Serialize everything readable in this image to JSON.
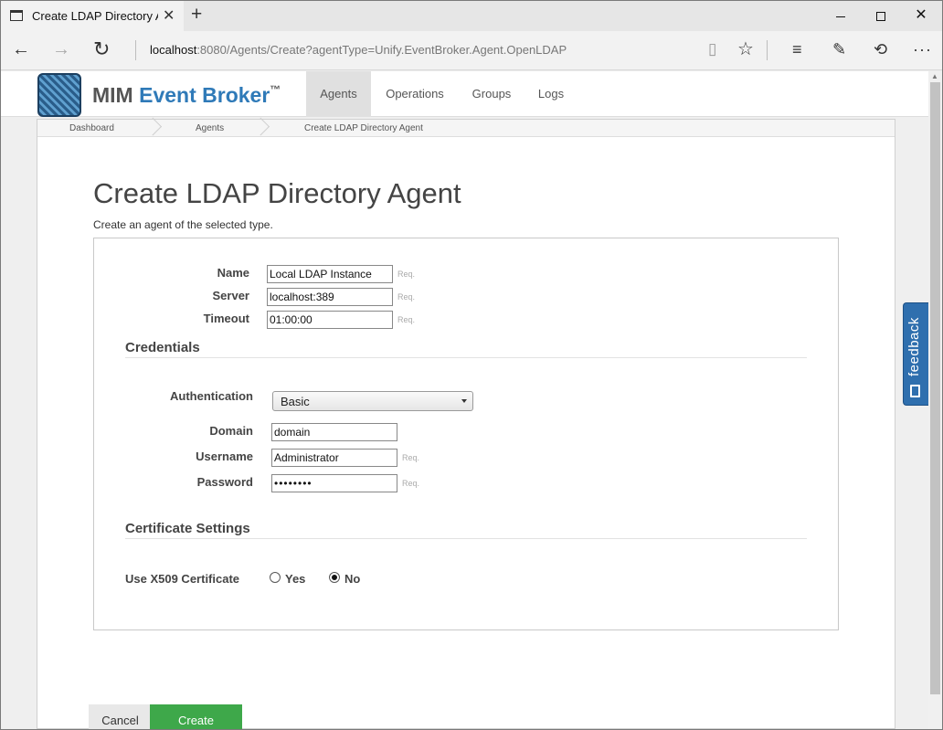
{
  "browser": {
    "tab_title": "Create LDAP Directory Agent",
    "tab_close": "✕",
    "new_tab": "+",
    "url_host": "localhost",
    "url_rest": ":8080/Agents/Create?agentType=Unify.EventBroker.Agent.OpenLDAP",
    "icons": {
      "back": "back-arrow-icon",
      "forward": "forward-arrow-icon",
      "refresh": "refresh-icon",
      "reading_view": "reading-view-icon",
      "favorite": "star-icon",
      "hub": "hub-icon",
      "web_note": "web-note-icon",
      "share": "share-icon",
      "more": "more-icon"
    }
  },
  "app": {
    "logo": {
      "mim": "MIM ",
      "event_broker": "Event Broker",
      "tm": "™"
    },
    "nav": [
      "Agents",
      "Operations",
      "Groups",
      "Logs"
    ],
    "active_nav": "Agents"
  },
  "breadcrumb": [
    "Dashboard",
    "Agents",
    "Create LDAP Directory Agent"
  ],
  "page": {
    "title": "Create LDAP Directory Agent",
    "subtitle": "Create an agent of the selected type."
  },
  "form": {
    "name": {
      "label": "Name",
      "value": "Local LDAP Instance",
      "req": "Req."
    },
    "server": {
      "label": "Server",
      "value": "localhost:389",
      "req": "Req."
    },
    "timeout": {
      "label": "Timeout",
      "value": "01:00:00",
      "req": "Req."
    },
    "credentials_heading": "Credentials",
    "authentication": {
      "label": "Authentication",
      "value": "Basic"
    },
    "domain": {
      "label": "Domain",
      "value": "domain"
    },
    "username": {
      "label": "Username",
      "value": "Administrator",
      "req": "Req."
    },
    "password": {
      "label": "Password",
      "value": "••••••••",
      "req": "Req."
    },
    "certificate_heading": "Certificate Settings",
    "x509": {
      "label": "Use X509 Certificate",
      "yes": "Yes",
      "no": "No",
      "selected": "No"
    }
  },
  "buttons": {
    "cancel": "Cancel",
    "create": "Create"
  },
  "feedback": {
    "label": "feedback"
  }
}
